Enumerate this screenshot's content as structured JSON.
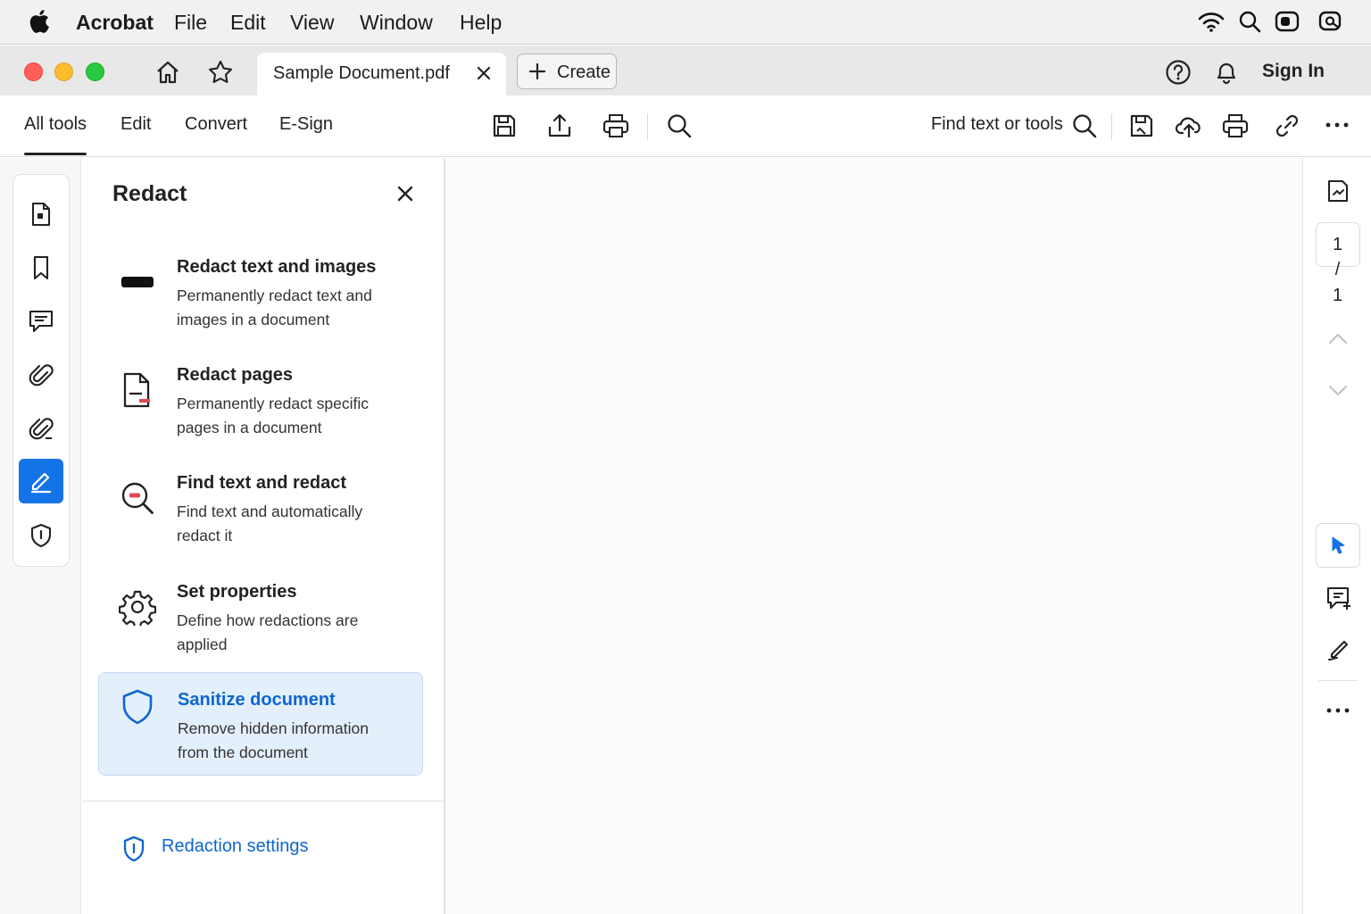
{
  "menubar": {
    "app_name": "Acrobat",
    "items": [
      "File",
      "Edit",
      "View",
      "Window",
      "Help"
    ]
  },
  "tabbar": {
    "document_tab": "Sample Document.pdf",
    "create_label": "Create",
    "sign_in_label": "Sign In"
  },
  "toolbar": {
    "tabs": [
      "All tools",
      "Edit",
      "Convert",
      "E-Sign"
    ],
    "active_tab": "All tools",
    "find_label": "Find text or tools"
  },
  "panel": {
    "title": "Redact",
    "tools": [
      {
        "title": "Redact text and images",
        "description": "Permanently redact text and images in a document",
        "icon": "redact-bar-icon"
      },
      {
        "title": "Redact pages",
        "description": "Permanently redact specific pages in a document",
        "icon": "redact-page-icon"
      },
      {
        "title": "Find text and redact",
        "description": "Find text and automatically redact it",
        "icon": "find-redact-icon"
      },
      {
        "title": "Set properties",
        "description": "Define how redactions are applied",
        "icon": "gear-icon"
      },
      {
        "title": "Sanitize document",
        "description": "Remove hidden information from the document",
        "icon": "shield-icon",
        "selected": true
      }
    ],
    "settings_link": "Redaction settings"
  },
  "pager": {
    "current": "1",
    "separator": "/",
    "total": "1"
  },
  "colors": {
    "accent": "#1473e6",
    "link": "#0d66d0",
    "selected_bg": "#e4effc",
    "close_red": "#ff5f57",
    "minimize_yellow": "#febc2e",
    "zoom_green": "#28c840"
  }
}
